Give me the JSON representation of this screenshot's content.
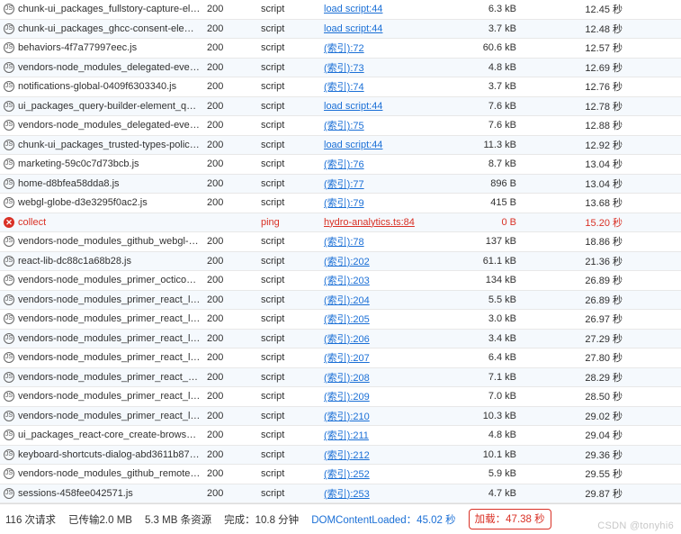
{
  "rows": [
    {
      "icon": "js",
      "name": "chunk-ui_packages_fullstory-capture-elem…",
      "status": "200",
      "type": "script",
      "initiator": "load script:44",
      "size": "6.3 kB",
      "time": "12.45 秒",
      "error": false
    },
    {
      "icon": "js",
      "name": "chunk-ui_packages_ghcc-consent-element…",
      "status": "200",
      "type": "script",
      "initiator": "load script:44",
      "size": "3.7 kB",
      "time": "12.48 秒",
      "error": false
    },
    {
      "icon": "js",
      "name": "behaviors-4f7a77997eec.js",
      "status": "200",
      "type": "script",
      "initiator": "(索引):72",
      "size": "60.6 kB",
      "time": "12.57 秒",
      "error": false
    },
    {
      "icon": "js",
      "name": "vendors-node_modules_delegated-events…",
      "status": "200",
      "type": "script",
      "initiator": "(索引):73",
      "size": "4.8 kB",
      "time": "12.69 秒",
      "error": false
    },
    {
      "icon": "js",
      "name": "notifications-global-0409f6303340.js",
      "status": "200",
      "type": "script",
      "initiator": "(索引):74",
      "size": "3.7 kB",
      "time": "12.76 秒",
      "error": false
    },
    {
      "icon": "js",
      "name": "ui_packages_query-builder-element_query…",
      "status": "200",
      "type": "script",
      "initiator": "load script:44",
      "size": "7.6 kB",
      "time": "12.78 秒",
      "error": false
    },
    {
      "icon": "js",
      "name": "vendors-node_modules_delegated-events…",
      "status": "200",
      "type": "script",
      "initiator": "(索引):75",
      "size": "7.6 kB",
      "time": "12.88 秒",
      "error": false
    },
    {
      "icon": "js",
      "name": "chunk-ui_packages_trusted-types-policies…",
      "status": "200",
      "type": "script",
      "initiator": "load script:44",
      "size": "11.3 kB",
      "time": "12.92 秒",
      "error": false
    },
    {
      "icon": "js",
      "name": "marketing-59c0c7d73bcb.js",
      "status": "200",
      "type": "script",
      "initiator": "(索引):76",
      "size": "8.7 kB",
      "time": "13.04 秒",
      "error": false
    },
    {
      "icon": "js",
      "name": "home-d8bfea58dda8.js",
      "status": "200",
      "type": "script",
      "initiator": "(索引):77",
      "size": "896 B",
      "time": "13.04 秒",
      "error": false
    },
    {
      "icon": "js",
      "name": "webgl-globe-d3e3295f0ac2.js",
      "status": "200",
      "type": "script",
      "initiator": "(索引):79",
      "size": "415 B",
      "time": "13.68 秒",
      "error": false
    },
    {
      "icon": "err",
      "name": "collect",
      "status": "",
      "type": "ping",
      "initiator": "hydro-analytics.ts:84",
      "size": "0 B",
      "time": "15.20 秒",
      "error": true
    },
    {
      "icon": "js",
      "name": "vendors-node_modules_github_webgl-glo…",
      "status": "200",
      "type": "script",
      "initiator": "(索引):78",
      "size": "137 kB",
      "time": "18.86 秒",
      "error": false
    },
    {
      "icon": "js",
      "name": "react-lib-dc88c1a68b28.js",
      "status": "200",
      "type": "script",
      "initiator": "(索引):202",
      "size": "61.1 kB",
      "time": "21.36 秒",
      "error": false
    },
    {
      "icon": "js",
      "name": "vendors-node_modules_primer_octicons-r…",
      "status": "200",
      "type": "script",
      "initiator": "(索引):203",
      "size": "134 kB",
      "time": "26.89 秒",
      "error": false
    },
    {
      "icon": "js",
      "name": "vendors-node_modules_primer_react_lib-e…",
      "status": "200",
      "type": "script",
      "initiator": "(索引):204",
      "size": "5.5 kB",
      "time": "26.89 秒",
      "error": false
    },
    {
      "icon": "js",
      "name": "vendors-node_modules_primer_react_lib-e…",
      "status": "200",
      "type": "script",
      "initiator": "(索引):205",
      "size": "3.0 kB",
      "time": "26.97 秒",
      "error": false
    },
    {
      "icon": "js",
      "name": "vendors-node_modules_primer_react_lib-e…",
      "status": "200",
      "type": "script",
      "initiator": "(索引):206",
      "size": "3.4 kB",
      "time": "27.29 秒",
      "error": false
    },
    {
      "icon": "js",
      "name": "vendors-node_modules_primer_react_lib-e…",
      "status": "200",
      "type": "script",
      "initiator": "(索引):207",
      "size": "6.4 kB",
      "time": "27.80 秒",
      "error": false
    },
    {
      "icon": "js",
      "name": "vendors-node_modules_primer_react_nod…",
      "status": "200",
      "type": "script",
      "initiator": "(索引):208",
      "size": "7.1 kB",
      "time": "28.29 秒",
      "error": false
    },
    {
      "icon": "js",
      "name": "vendors-node_modules_primer_react_lib-e…",
      "status": "200",
      "type": "script",
      "initiator": "(索引):209",
      "size": "7.0 kB",
      "time": "28.50 秒",
      "error": false
    },
    {
      "icon": "js",
      "name": "vendors-node_modules_primer_react_lib-e…",
      "status": "200",
      "type": "script",
      "initiator": "(索引):210",
      "size": "10.3 kB",
      "time": "29.02 秒",
      "error": false
    },
    {
      "icon": "js",
      "name": "ui_packages_react-core_create-browser-hi…",
      "status": "200",
      "type": "script",
      "initiator": "(索引):211",
      "size": "4.8 kB",
      "time": "29.04 秒",
      "error": false
    },
    {
      "icon": "js",
      "name": "keyboard-shortcuts-dialog-abd3611b87d…",
      "status": "200",
      "type": "script",
      "initiator": "(索引):212",
      "size": "10.1 kB",
      "time": "29.36 秒",
      "error": false
    },
    {
      "icon": "js",
      "name": "vendors-node_modules_github_remote-fo…",
      "status": "200",
      "type": "script",
      "initiator": "(索引):252",
      "size": "5.9 kB",
      "time": "29.55 秒",
      "error": false
    },
    {
      "icon": "js",
      "name": "sessions-458fee042571.js",
      "status": "200",
      "type": "script",
      "initiator": "(索引):253",
      "size": "4.7 kB",
      "time": "29.87 秒",
      "error": false
    }
  ],
  "status": {
    "requests": "116 次请求",
    "transferred": "已传输2.0 MB",
    "resources": "5.3 MB 条资源",
    "finish_label": "完成：",
    "finish_value": "10.8 分钟",
    "dcl_label": "DOMContentLoaded：",
    "dcl_value": "45.02 秒",
    "load_label": "加载：",
    "load_value": "47.38 秒"
  },
  "watermark": "CSDN @tonyhi6"
}
